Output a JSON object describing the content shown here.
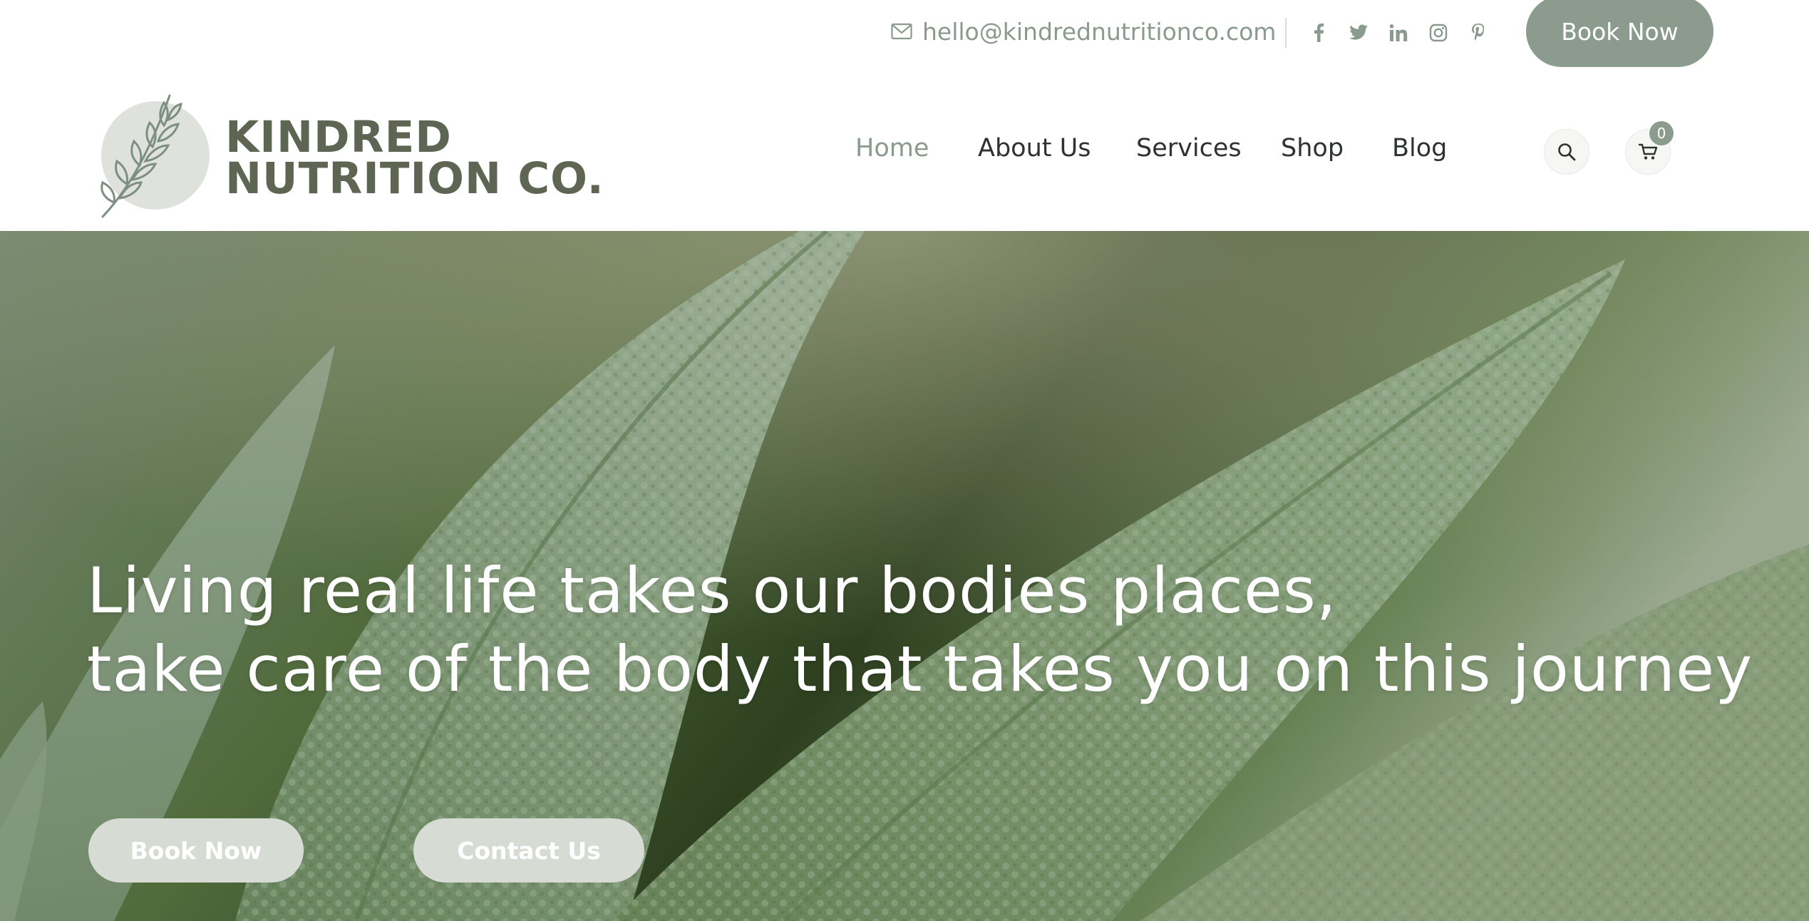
{
  "topbar": {
    "email": "hello@kindrednutritionco.com",
    "email_icon": "mail-icon",
    "social": [
      "facebook-icon",
      "twitter-icon",
      "linkedin-icon",
      "instagram-icon",
      "pinterest-icon"
    ],
    "book_label": "Book Now"
  },
  "brand": {
    "line1": "KINDRED",
    "line2": "NUTRITION CO.",
    "logo_icon": "leaf-sprig-icon",
    "color": "#5f6553"
  },
  "nav": {
    "items": [
      {
        "label": "Home",
        "active": true
      },
      {
        "label": "About Us",
        "active": false
      },
      {
        "label": "Services",
        "active": false
      },
      {
        "label": "Shop",
        "active": false
      },
      {
        "label": "Blog",
        "active": false
      }
    ],
    "search_icon": "search-icon",
    "cart_icon": "cart-icon",
    "cart_count": "0"
  },
  "hero": {
    "line1": "Living real life takes our bodies places,",
    "line2": "take care of the body that takes you on this journey",
    "book_label": "Book Now",
    "contact_label": "Contact Us",
    "background": "sage-leaves-photo"
  },
  "colors": {
    "accent": "#8b9c8e",
    "text": "#2e3230",
    "button_light": "#d6dbd3"
  }
}
